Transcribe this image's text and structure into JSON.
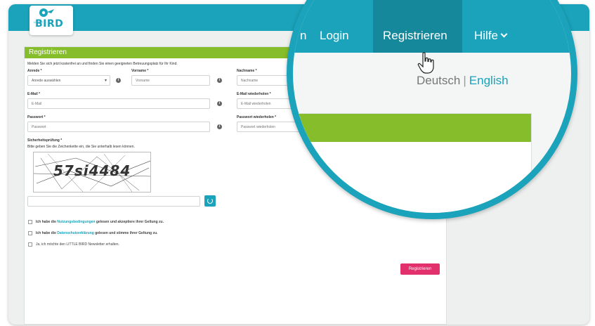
{
  "brand": {
    "logo_word": "BIRD",
    "logo_small": "LITTLE"
  },
  "form": {
    "panel_title": "Registrieren",
    "intro": "Melden Sie sich jetzt kostenfrei an und finden Sie einen geeigneten Betreuungsplatz für Ihr Kind.",
    "anrede_label": "Anrede *",
    "anrede_value": "Anrede auswählen",
    "vorname_label": "Vorname *",
    "vorname_placeholder": "Vorname",
    "nachname_label": "Nachname *",
    "nachname_placeholder": "Nachname",
    "email_label": "E-Mail *",
    "email_placeholder": "E-Mail",
    "email_repeat_label": "E-Mail wiederholen *",
    "email_repeat_placeholder": "E-Mail wiederholen",
    "password_label": "Passwort *",
    "password_placeholder": "Passwort",
    "password_repeat_label": "Passwort wiederholen *",
    "password_repeat_placeholder": "Passwort wiederholen",
    "security_label": "Sicherheitsprüfung *",
    "security_hint": "Bitte geben Sie die Zeichenkette ein, die Sie unterhalb lesen können.",
    "captcha_code": "57si4484",
    "checkbox_1_pre": "Ich habe die ",
    "checkbox_1_link": "Nutzungsbedingungen",
    "checkbox_1_post": " gelesen und akzeptiere ihrer Geltung zu.",
    "checkbox_2_pre": "Ich habe die ",
    "checkbox_2_link": "Datenschutzerklärung",
    "checkbox_2_post": " gelesen und stimme ihrer Geltung zu.",
    "checkbox_3": "Ja, ich möchte den LITTLE BIRD Newsletter erhalten.",
    "submit_label": "Registrieren"
  },
  "lens": {
    "nav_partial": "n",
    "nav_login": "Login",
    "nav_register": "Registrieren",
    "nav_help": "Hilfe",
    "lang_de": "Deutsch",
    "lang_sep": "|",
    "lang_en": "English",
    "field_label": "name *"
  },
  "colors": {
    "brand_teal": "#1aa3ba",
    "active_teal": "#16889c",
    "panel_green": "#86bd2a",
    "submit_pink": "#e2306c"
  },
  "icons": [
    "bird-logo-icon",
    "info-icon",
    "chevron-down-icon",
    "refresh-icon",
    "hand-pointer-icon"
  ]
}
